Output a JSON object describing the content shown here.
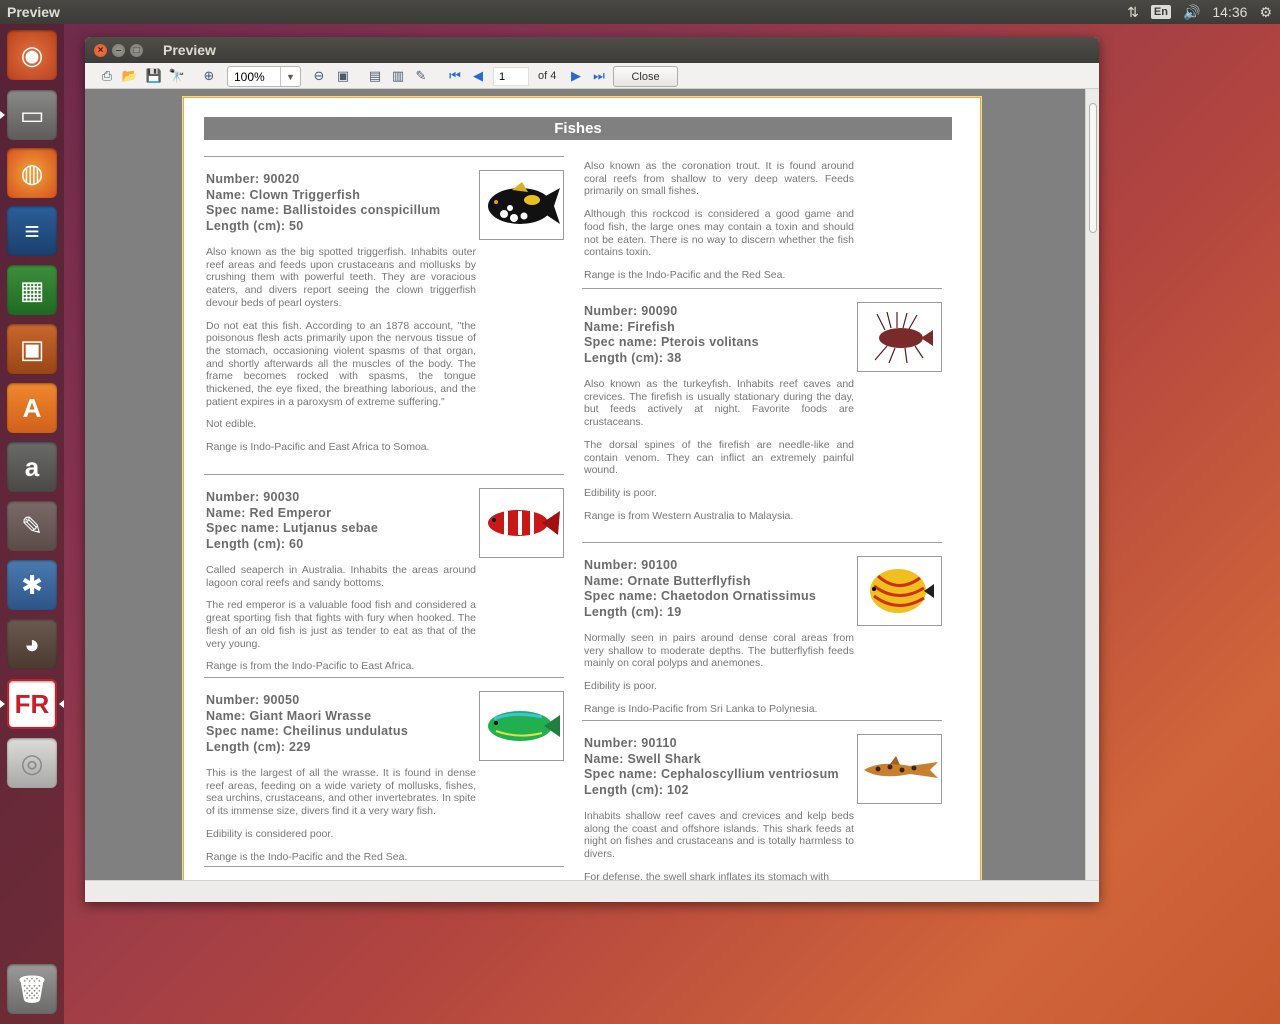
{
  "topbar": {
    "app_title": "Preview",
    "lang": "En",
    "time": "14:36"
  },
  "launcher": {
    "items": [
      "ubuntu-dash",
      "files",
      "firefox",
      "libreoffice-writer",
      "libreoffice-calc",
      "libreoffice-impress",
      "ubuntu-software-center",
      "amazon",
      "system-settings",
      "gnome-tweak",
      "gimp",
      "fastreport",
      "dvd",
      "trash"
    ]
  },
  "window": {
    "title": "Preview"
  },
  "toolbar": {
    "zoom": "100%",
    "page": "1",
    "of_label": "of 4",
    "close_label": "Close"
  },
  "report": {
    "title": "Fishes",
    "left": [
      {
        "number": "Number: 90020",
        "name": "Name: Clown Triggerfish",
        "spec": "Spec name: Ballistoides conspicillum",
        "length": "Length (cm): 50",
        "paras": [
          "Also known as the big spotted triggerfish.  Inhabits outer reef areas and feeds upon crustaceans and mollusks by crushing them with powerful teeth.  They are voracious eaters, and divers report seeing the clown triggerfish devour beds of pearl oysters.",
          "Do not eat this fish.  According to an 1878 account, \"the poisonous flesh acts primarily upon the nervous tissue of the stomach, occasioning violent spasms of that organ, and shortly afterwards all the muscles of the body.  The frame becomes rocked with spasms, the tongue thickened, the eye fixed, the breathing laborious, and the patient expires in a paroxysm of extreme suffering.\"",
          "Not edible.",
          "Range is Indo-Pacific and East Africa to Somoa."
        ]
      },
      {
        "number": "Number: 90030",
        "name": "Name: Red Emperor",
        "spec": "Spec name: Lutjanus sebae",
        "length": "Length (cm): 60",
        "paras": [
          "Called seaperch in Australia.  Inhabits the areas around lagoon coral reefs and sandy bottoms.",
          "The red emperor is a valuable food fish and considered a great sporting fish that fights with fury when hooked.  The flesh of an old fish is just as tender to eat as that of the very young.",
          "Range is from the Indo-Pacific to East Africa."
        ]
      },
      {
        "number": "Number: 90050",
        "name": "Name: Giant Maori Wrasse",
        "spec": "Spec name: Cheilinus undulatus",
        "length": "Length (cm): 229",
        "paras": [
          "This is the largest of all the wrasse.  It is found in dense reef areas, feeding on a wide variety of mollusks, fishes, sea urchins, crustaceans, and other invertebrates. In spite of its immense size, divers find it a very wary fish.",
          "Edibility is considered poor.",
          "Range is the Indo-Pacific and the Red Sea."
        ]
      }
    ],
    "right_top": [
      "Also known as the coronation trout.  It is found around coral reefs from shallow to very deep waters.  Feeds primarily on small fishes.",
      "Although this rockcod is considered a good game and food fish, the large ones may contain a toxin and should not be eaten.  There is no way to discern whether the fish contains toxin.",
      "Range is the Indo-Pacific and the Red Sea."
    ],
    "right": [
      {
        "number": "Number: 90090",
        "name": "Name: Firefish",
        "spec": "Spec name: Pterois volitans",
        "length": "Length (cm): 38",
        "paras": [
          "Also known as the turkeyfish.  Inhabits reef caves and crevices.  The firefish is usually stationary during the day, but feeds actively at night.  Favorite foods are crustaceans.",
          "The dorsal spines of the firefish are needle-like and contain venom.  They can inflict an extremely painful wound.",
          "Edibility is poor.",
          "Range is from Western Australia to Malaysia."
        ]
      },
      {
        "number": "Number: 90100",
        "name": "Name: Ornate Butterflyfish",
        "spec": "Spec name: Chaetodon Ornatissimus",
        "length": "Length (cm): 19",
        "paras": [
          "Normally seen in pairs around dense coral areas from very shallow to moderate depths.  The butterflyfish feeds mainly on coral polyps and anemones.",
          "Edibility is poor.",
          "Range is Indo-Pacific from Sri Lanka to Polynesia."
        ]
      },
      {
        "number": "Number: 90110",
        "name": "Name: Swell Shark",
        "spec": "Spec name: Cephaloscyllium ventriosum",
        "length": "Length (cm): 102",
        "paras": [
          "Inhabits shallow reef caves and crevices and kelp beds along the coast and offshore islands.  This shark feeds at night on fishes and crustaceans and is totally harmless to divers.",
          "For defense, the swell shark inflates its stomach with"
        ]
      }
    ]
  }
}
